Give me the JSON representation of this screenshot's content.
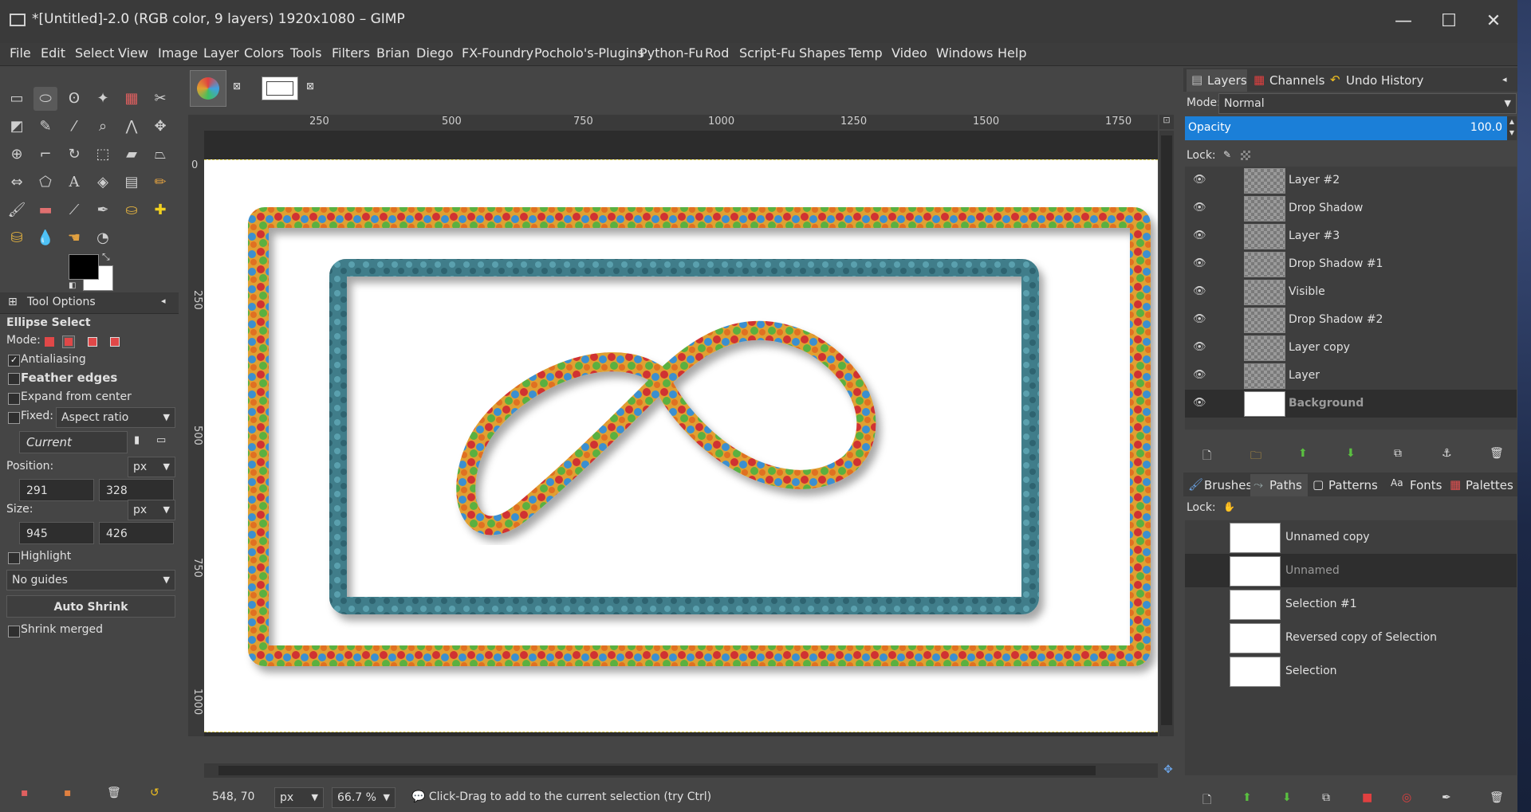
{
  "window": {
    "title": "*[Untitled]-2.0 (RGB color, 9 layers) 1920x1080 – GIMP",
    "controls": {
      "minimize": "—",
      "maximize": "☐",
      "close": "✕"
    }
  },
  "menubar": [
    "File",
    "Edit",
    "Select",
    "View",
    "Image",
    "Layer",
    "Colors",
    "Tools",
    "Filters",
    "Brian",
    "Diego",
    "FX-Foundry",
    "Pocholo's-Plugins",
    "Python-Fu",
    "Rod",
    "Script-Fu",
    "Shapes",
    "Temp",
    "Video",
    "Windows",
    "Help"
  ],
  "tool_options": {
    "tab_label": "Tool Options",
    "tool_name": "Ellipse Select",
    "mode_label": "Mode:",
    "antialiasing": {
      "label": "Antialiasing",
      "checked": true
    },
    "feather_edges": {
      "label": "Feather edges",
      "checked": false
    },
    "expand_from_center": {
      "label": "Expand from center",
      "checked": false
    },
    "fixed": {
      "label": "Fixed:",
      "value": "Aspect ratio",
      "checked": false
    },
    "current": "Current",
    "position": {
      "label": "Position:",
      "unit": "px",
      "x": "291",
      "y": "328"
    },
    "size": {
      "label": "Size:",
      "unit": "px",
      "w": "945",
      "h": "426"
    },
    "highlight": {
      "label": "Highlight",
      "checked": false
    },
    "guides": "No guides",
    "auto_shrink": "Auto Shrink",
    "shrink_merged": {
      "label": "Shrink merged",
      "checked": false
    }
  },
  "rulers": {
    "top": [
      "250",
      "500",
      "750",
      "1000",
      "1250",
      "1500",
      "1750"
    ],
    "left": [
      "0",
      "250",
      "500",
      "750",
      "1000"
    ]
  },
  "statusbar": {
    "coords": "548, 70",
    "unit": "px",
    "zoom": "66.7 %",
    "message": "Click-Drag to add to the current selection (try Ctrl)"
  },
  "layers_dock": {
    "tabs": [
      "Layers",
      "Channels",
      "Undo History"
    ],
    "mode_label": "Mode:",
    "mode_value": "Normal",
    "opacity_label": "Opacity",
    "opacity_value": "100.0",
    "lock_label": "Lock:",
    "layers": [
      "Layer #2",
      "Drop Shadow",
      "Layer #3",
      "Drop Shadow #1",
      "Visible",
      "Drop Shadow #2",
      "Layer copy",
      "Layer",
      "Background"
    ],
    "selected_layer": "Background"
  },
  "paths_dock": {
    "tabs": [
      "Brushes",
      "Paths",
      "Patterns",
      "Fonts",
      "Palettes"
    ],
    "lock_label": "Lock:",
    "paths": [
      "Unnamed copy",
      "Unnamed",
      "Selection #1",
      "Reversed copy of Selection",
      "Selection"
    ],
    "selected_path": "Unnamed"
  },
  "colors": {
    "accent": "#1b7fd8",
    "frame_outer": "#e0a030",
    "frame_inner": "#3f7d8a"
  }
}
